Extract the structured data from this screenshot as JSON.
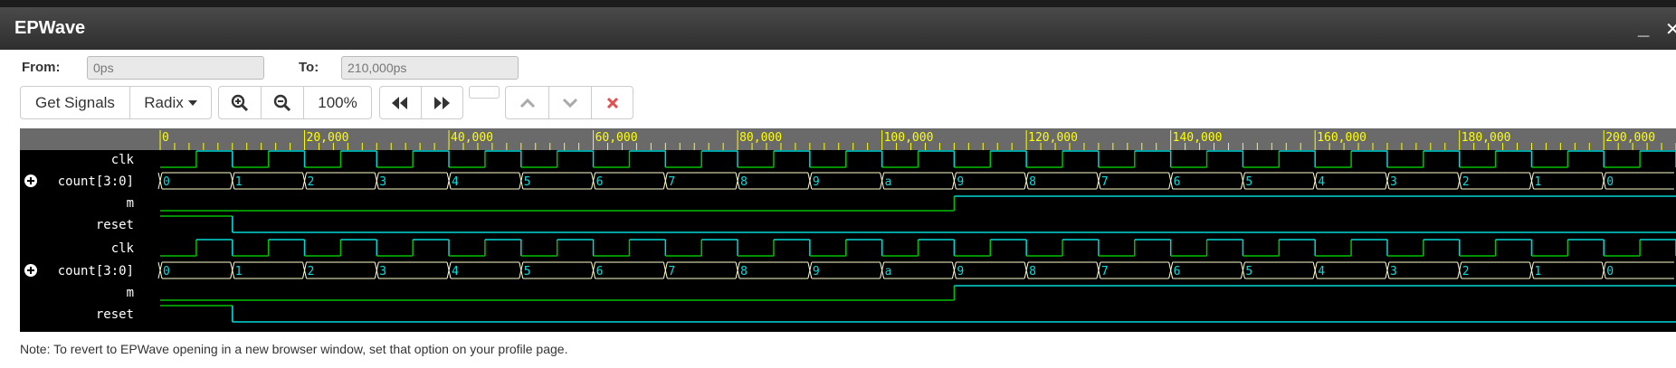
{
  "window": {
    "title": "EPWave",
    "minimize_glyph": "_",
    "close_glyph": "✕"
  },
  "range": {
    "from_label": "From:",
    "from_value": "0ps",
    "to_label": "To:",
    "to_value": "210,000ps"
  },
  "toolbar": {
    "get_signals_label": "Get Signals",
    "radix_label": "Radix",
    "zoom_in_icon": "zoom-in-icon",
    "zoom_out_icon": "zoom-out-icon",
    "zoom_level": "100%",
    "rewind_icon": "rewind-icon",
    "fast_forward_icon": "fast-forward-icon",
    "up_icon": "chevron-up-icon",
    "down_icon": "chevron-down-icon",
    "remove_icon": "remove-icon"
  },
  "ruler": {
    "labels": [
      "0",
      "20,000",
      "40,000",
      "60,000",
      "80,000",
      "100,000",
      "120,000",
      "140,000",
      "160,000",
      "180,000",
      "200,000"
    ],
    "range_ps": [
      0,
      210000
    ]
  },
  "signals": [
    {
      "name": "clk",
      "type": "clock",
      "expandable": false
    },
    {
      "name": "count[3:0]",
      "type": "bus",
      "expandable": true,
      "values": [
        "0",
        "1",
        "2",
        "3",
        "4",
        "5",
        "6",
        "7",
        "8",
        "9",
        "a",
        "9",
        "8",
        "7",
        "6",
        "5",
        "4",
        "3",
        "2",
        "1",
        "0"
      ]
    },
    {
      "name": "m",
      "type": "bit",
      "expandable": false
    },
    {
      "name": "reset",
      "type": "bit",
      "expandable": false
    },
    {
      "name": "clk",
      "type": "clock",
      "expandable": false
    },
    {
      "name": "count[3:0]",
      "type": "bus",
      "expandable": true,
      "values": [
        "0",
        "1",
        "2",
        "3",
        "4",
        "5",
        "6",
        "7",
        "8",
        "9",
        "a",
        "9",
        "8",
        "7",
        "6",
        "5",
        "4",
        "3",
        "2",
        "1",
        "0"
      ]
    },
    {
      "name": "m",
      "type": "bit",
      "expandable": false
    },
    {
      "name": "reset",
      "type": "bit",
      "expandable": false
    }
  ],
  "colors": {
    "high": "#00d8d8",
    "low": "#00c000",
    "bus": "#ffffcc",
    "bus_text": "#00e0e0",
    "ruler_text": "#ffff00"
  },
  "note": "Note: To revert to EPWave opening in a new browser window, set that option on your profile page."
}
